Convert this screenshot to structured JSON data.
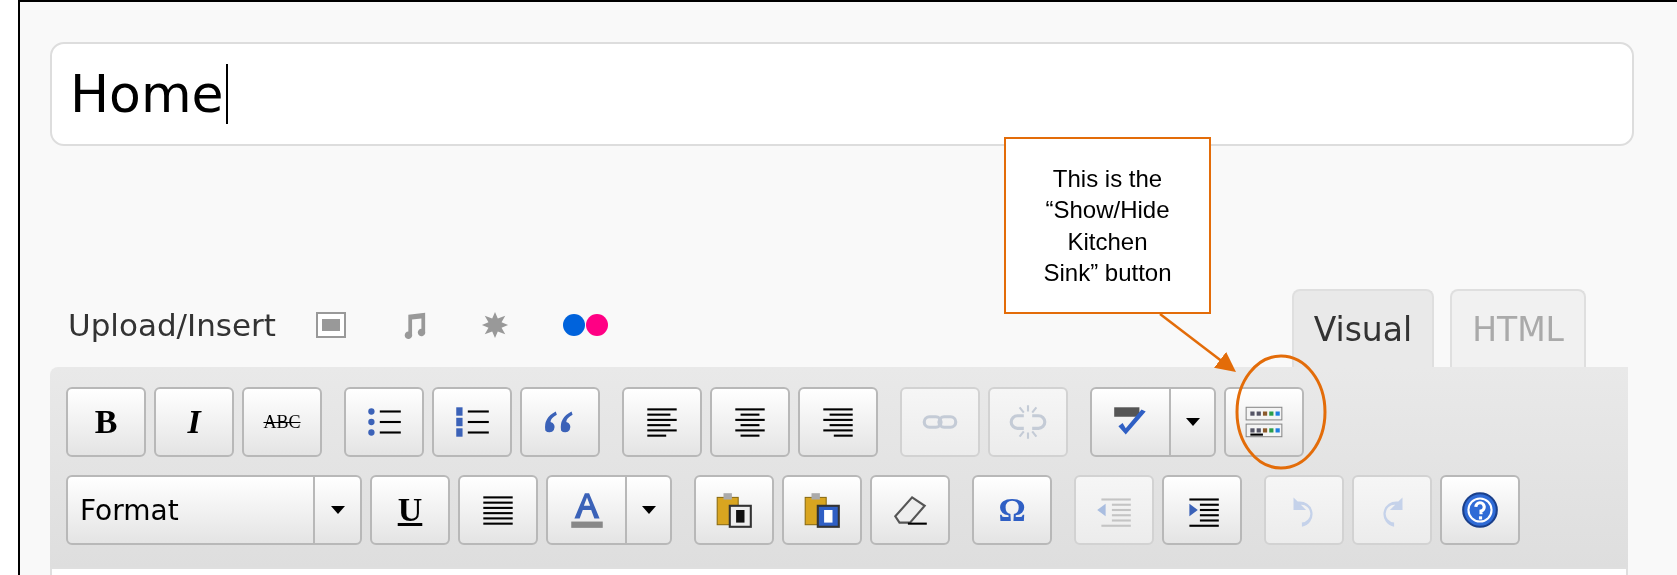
{
  "title_field": {
    "value": "Home"
  },
  "media": {
    "label": "Upload/Insert"
  },
  "tabs": [
    {
      "label": "Visual",
      "selected": true
    },
    {
      "label": "HTML",
      "selected": false
    }
  ],
  "toolbar": {
    "rows": [
      {
        "groups": [
          {
            "buttons": [
              {
                "kind": "bold",
                "label": "B",
                "disabled": false
              },
              {
                "kind": "italic",
                "label": "I",
                "disabled": false
              },
              {
                "kind": "strike",
                "label": "ABC",
                "disabled": false
              }
            ]
          },
          {
            "buttons": [
              {
                "kind": "bullist",
                "disabled": false
              },
              {
                "kind": "numlist",
                "disabled": false
              },
              {
                "kind": "blockquote",
                "disabled": false
              }
            ]
          },
          {
            "buttons": [
              {
                "kind": "alignleft",
                "disabled": false
              },
              {
                "kind": "aligncenter",
                "disabled": false
              },
              {
                "kind": "alignright",
                "disabled": false
              }
            ]
          },
          {
            "buttons": [
              {
                "kind": "link",
                "disabled": true
              },
              {
                "kind": "unlink",
                "disabled": true
              }
            ]
          },
          {
            "buttons": [
              {
                "kind": "spellcheck",
                "dropdown": true,
                "disabled": false
              },
              {
                "kind": "kitchensink",
                "disabled": false
              }
            ]
          }
        ]
      },
      {
        "groups": [
          {
            "buttons": [
              {
                "kind": "select",
                "label": "Format",
                "dropdown": true,
                "disabled": false
              },
              {
                "kind": "underline",
                "label": "U",
                "disabled": false
              },
              {
                "kind": "justify",
                "disabled": false
              },
              {
                "kind": "forecolor",
                "dropdown": true,
                "disabled": false
              }
            ]
          },
          {
            "buttons": [
              {
                "kind": "pastetext",
                "disabled": false
              },
              {
                "kind": "pasteword",
                "disabled": false
              },
              {
                "kind": "removeformat",
                "disabled": false
              }
            ]
          },
          {
            "buttons": [
              {
                "kind": "charmap",
                "label": "Ω",
                "disabled": false
              }
            ]
          },
          {
            "buttons": [
              {
                "kind": "outdent",
                "disabled": true
              },
              {
                "kind": "indent",
                "disabled": false
              }
            ]
          },
          {
            "buttons": [
              {
                "kind": "undo",
                "disabled": true
              },
              {
                "kind": "redo",
                "disabled": true
              },
              {
                "kind": "help",
                "disabled": false
              }
            ]
          }
        ]
      }
    ]
  },
  "callout": {
    "text": "This is the “Show/Hide Kitchen Sink” button"
  }
}
